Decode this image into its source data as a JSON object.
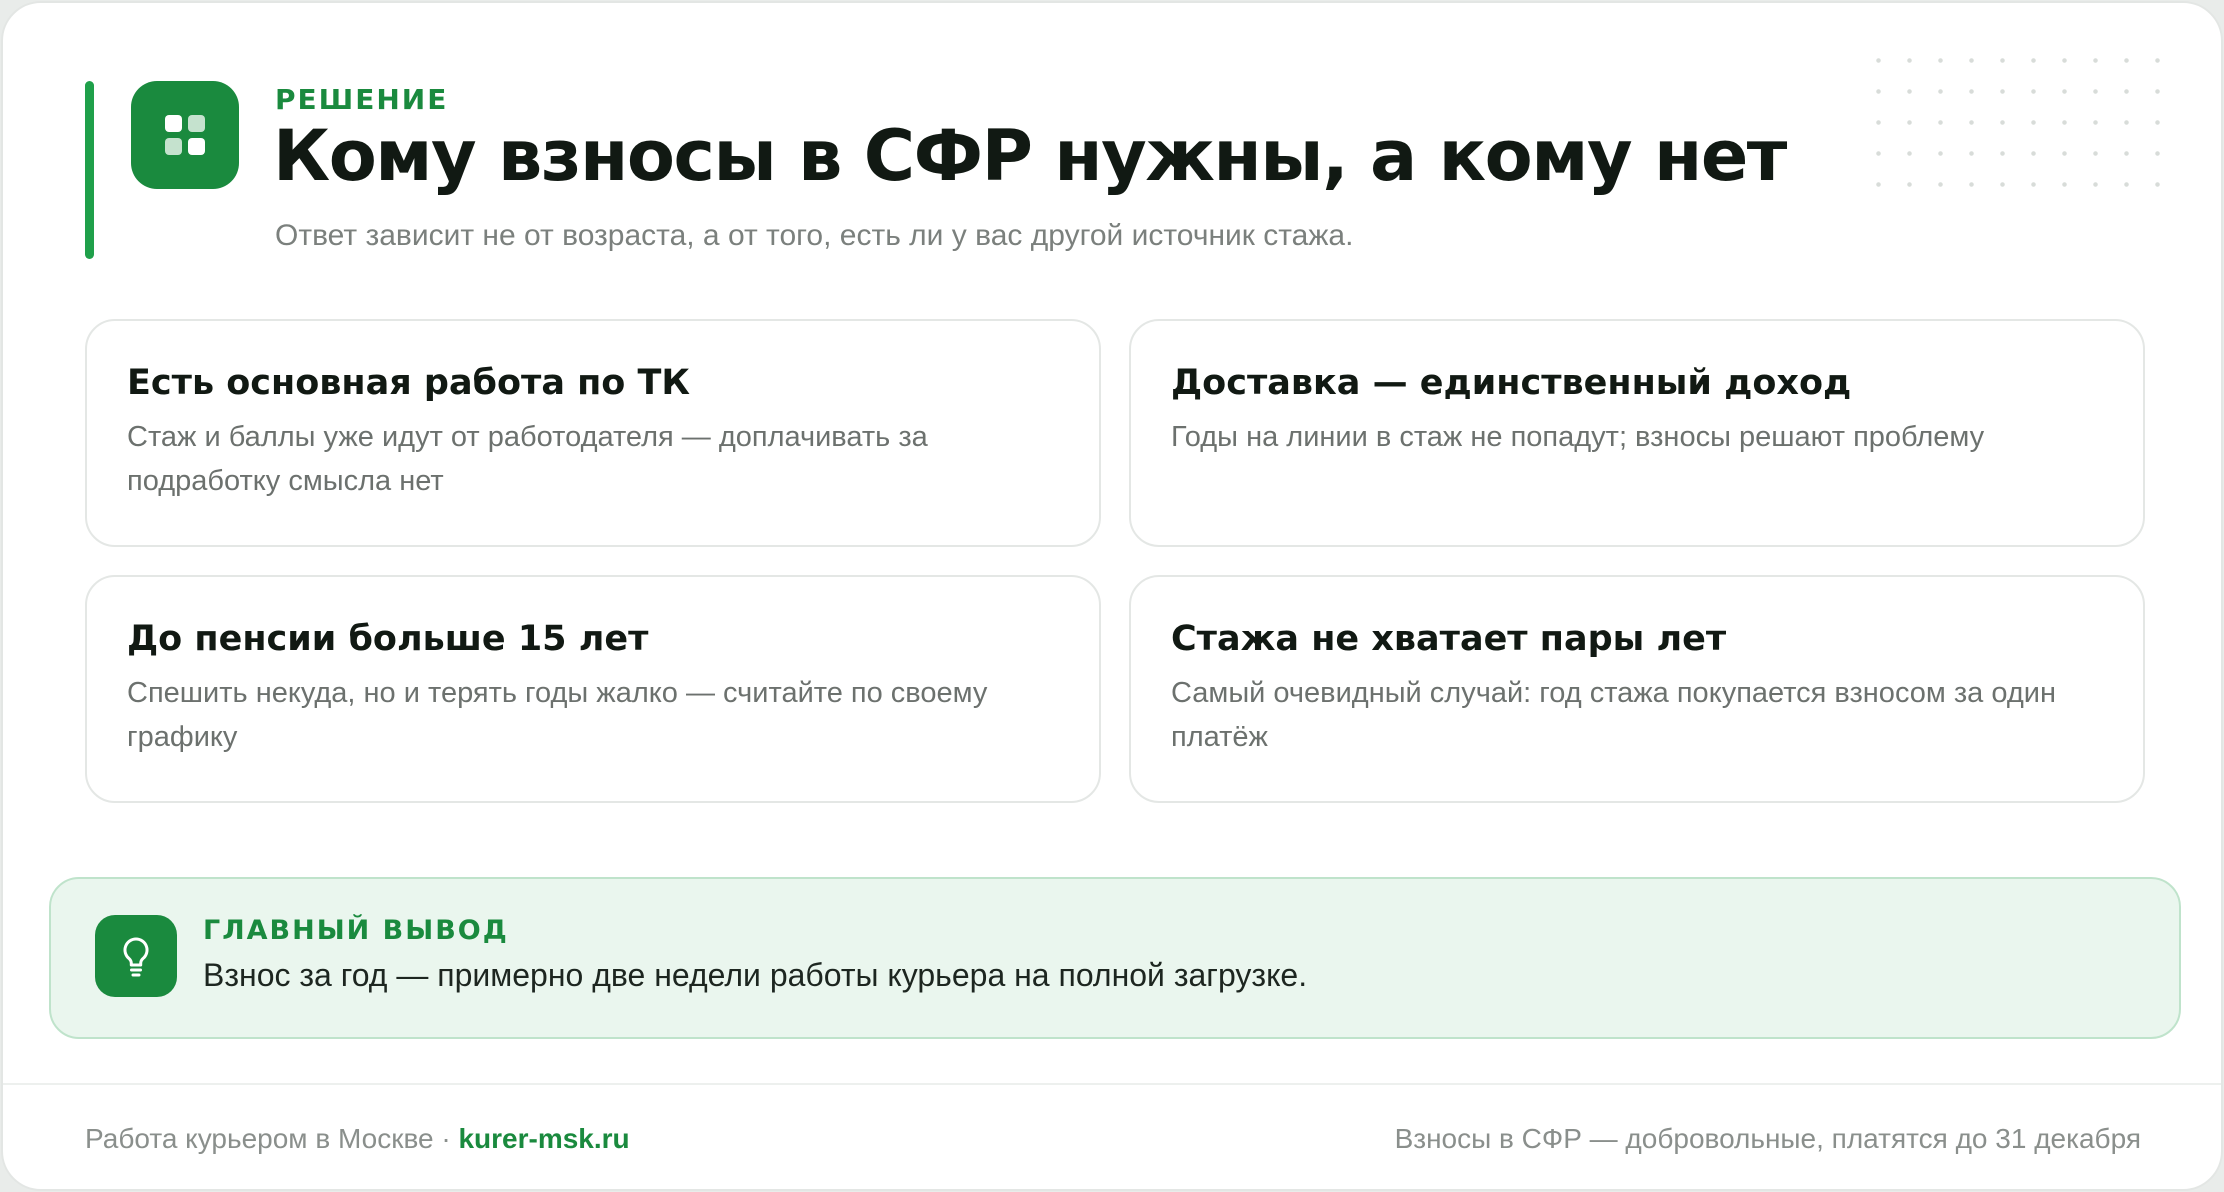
{
  "header": {
    "eyebrow": "РЕШЕНИЕ",
    "title": "Кому взносы в СФР нужны, а кому нет",
    "subtitle": "Ответ зависит не от возраста, а от того, есть ли у вас другой источник стажа.",
    "logo_icon": "grid-icon"
  },
  "cards": [
    {
      "title": "Есть основная работа по ТК",
      "text": "Стаж и баллы уже идут от работодателя — доплачивать за подработку смысла нет"
    },
    {
      "title": "Доставка — единственный доход",
      "text": "Годы на линии в стаж не попадут; взносы решают проблему"
    },
    {
      "title": "До пенсии больше 15 лет",
      "text": "Спешить некуда, но и терять годы жалко — считайте по своему графику"
    },
    {
      "title": "Стажа не хватает пары лет",
      "text": "Самый очевидный случай: год стажа покупается взносом за один платёж"
    }
  ],
  "conclusion": {
    "label": "ГЛАВНЫЙ ВЫВОД",
    "text": "Взнос за год — примерно две недели работы курьера на полной загрузке.",
    "icon": "lightbulb-icon"
  },
  "footer": {
    "left_text": "Работа курьером в Москве · ",
    "link_text": "kurer-msk.ru",
    "right_text": "Взносы в СФР — добровольные, платятся до 31 декабря"
  },
  "colors": {
    "accent": "#1a8a3e",
    "accent_bar": "#1fa04a",
    "conclusion_bg": "#eaf6ee"
  }
}
